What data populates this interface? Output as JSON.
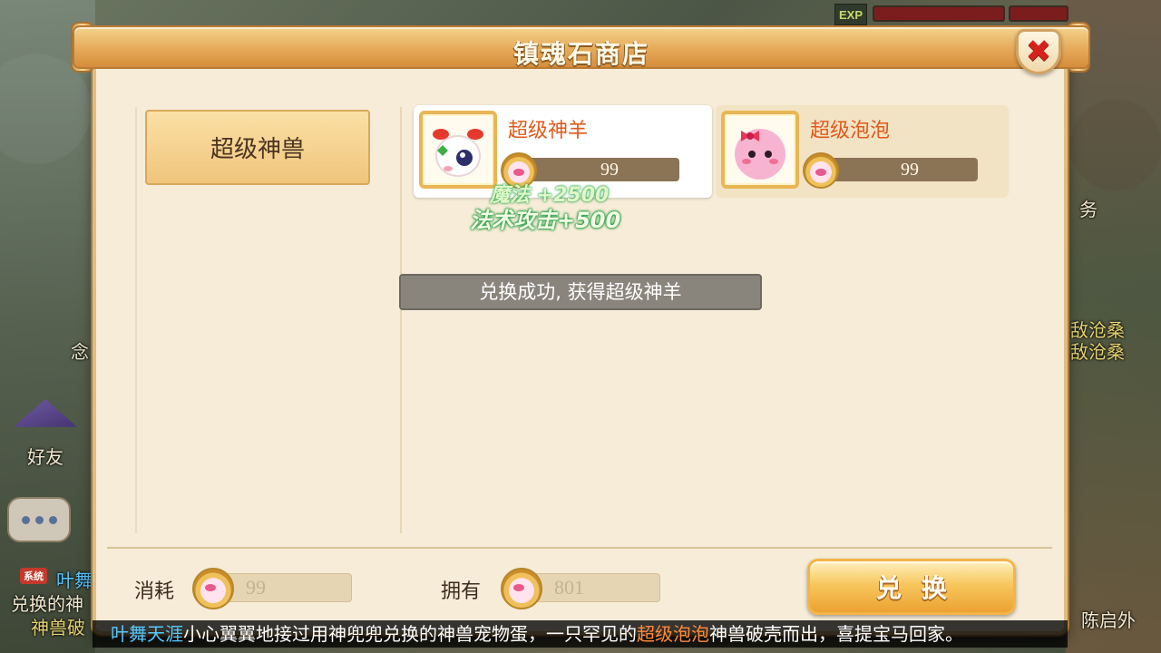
{
  "window": {
    "title": "镇魂石商店"
  },
  "hud": {
    "exp_label": "EXP"
  },
  "side_texts": {
    "friend": "好友",
    "system_tag": "系统",
    "left_line1": "兑换的神",
    "left_line2": "神兽破",
    "left_name": "叶舞",
    "left_misc": "念",
    "right_a": "敌沧桑",
    "right_b": "敌沧桑",
    "right_task": "务",
    "right_name": "陈启外"
  },
  "categories": [
    {
      "label": "超级神兽",
      "selected": true
    }
  ],
  "items": [
    {
      "name": "超级神羊",
      "price": "99",
      "selected": true,
      "icon": "sheep-pet-icon"
    },
    {
      "name": "超级泡泡",
      "price": "99",
      "selected": false,
      "icon": "bubble-pet-icon"
    }
  ],
  "floating_stats": {
    "magic": "魔法 +2500",
    "spell_attack": "法术攻击+500"
  },
  "toast": "兑换成功, 获得超级神羊",
  "footer": {
    "cost_label": "消耗",
    "cost_value": "99",
    "own_label": "拥有",
    "own_value": "801",
    "exchange_label_1": "兑",
    "exchange_label_2": "换",
    "currency_icon": "soul-stone-coin-icon"
  },
  "marquee": {
    "player": "叶舞天涯",
    "text_a": "小心翼翼地接过用神兜兜兑换的神兽宠物蛋，一只罕见的",
    "pet": "超级泡泡",
    "text_b": "神兽破壳而出，喜提宝马回家。"
  },
  "colors": {
    "accent": "#e6aa59",
    "panel": "#f6ecd8",
    "item_name": "#e05a1c",
    "close": "#d4231d"
  }
}
